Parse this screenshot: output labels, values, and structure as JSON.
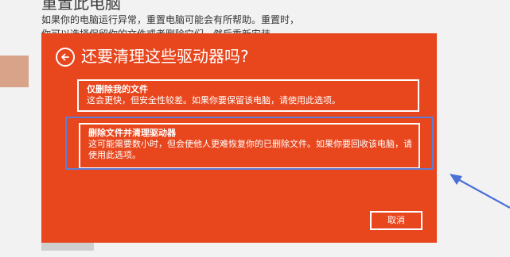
{
  "background": {
    "title": "重置此电脑",
    "description": "如果你的电脑运行异常，重置电脑可能会有所帮助。重置时，你可以选择保留你的文件或者删除它们，然后重新安装 Windows"
  },
  "dialog": {
    "title": "还要清理这些驱动器吗?",
    "options": [
      {
        "title": "仅删除我的文件",
        "description": "这会更快，但安全性较差。如果你要保留该电脑，请使用此选项。"
      },
      {
        "title": "删除文件并清理驱动器",
        "description": "这可能需要数小时，但会使他人更难恢复你的已删除文件。如果你要回收该电脑，请使用此选项。"
      }
    ],
    "cancel_label": "取消"
  },
  "colors": {
    "dialog_bg": "#e8461d",
    "highlight": "#5b7fd6",
    "arrow": "#4a6fd6"
  },
  "icons": {
    "back": "back-arrow-icon"
  }
}
